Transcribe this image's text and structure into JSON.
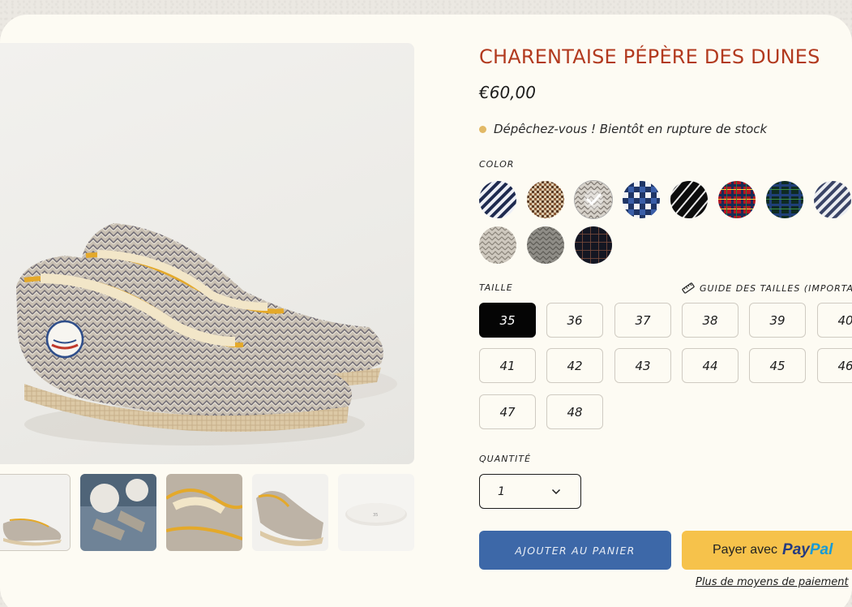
{
  "product": {
    "title": "CHARENTAISE PÉPÈRE DES DUNES",
    "price": "€60,00",
    "stock_message": "Dépêchez-vous ! Bientôt en rupture de stock",
    "accent_color": "#b23a1f"
  },
  "gallery": {
    "thumbnail_count": 5,
    "active_thumbnail": 1
  },
  "color": {
    "label": "COLOR",
    "selected_index": 2,
    "swatches": [
      "navy-stripe",
      "brown-houndstooth",
      "grey-herringbone",
      "blue-check",
      "black-white-stripe",
      "red-tartan",
      "green-tartan",
      "grey-stripe",
      "light-herringbone",
      "dark-herringbone",
      "navy-windowpane"
    ]
  },
  "size": {
    "label": "TAILLE",
    "guide_label": "GUIDE DES TAILLES (IMPORTANT)",
    "selected": "35",
    "options": [
      "35",
      "36",
      "37",
      "38",
      "39",
      "40",
      "41",
      "42",
      "43",
      "44",
      "45",
      "46",
      "47",
      "48"
    ]
  },
  "quantity": {
    "label": "QUANTITÉ",
    "value": "1"
  },
  "actions": {
    "add_to_cart": "AJOUTER AU PANIER",
    "paypal_prefix": "Payer avec",
    "paypal_brand_1": "Pay",
    "paypal_brand_2": "Pal",
    "more_payment": "Plus de moyens de paiement",
    "add_to_cart_color": "#3d68a8",
    "paypal_color": "#f6c24b"
  }
}
